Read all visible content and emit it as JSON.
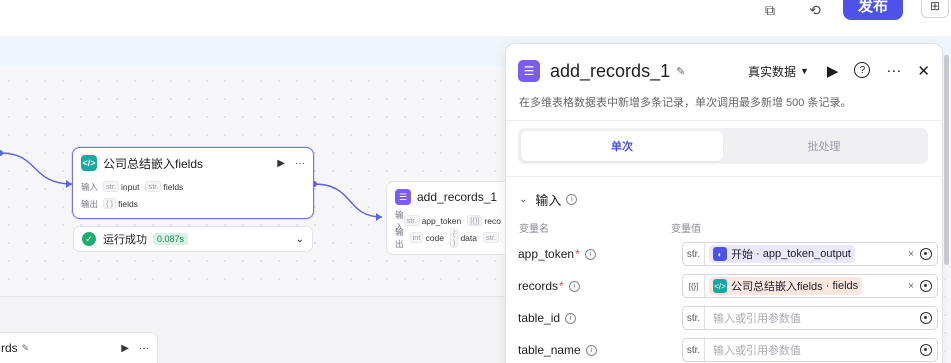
{
  "toolbar": {
    "publish_label": "发布"
  },
  "canvas": {
    "node_embed": {
      "title": "公司总结嵌入fields",
      "run_icon": "▶",
      "more_icon": "···",
      "input_label": "输入",
      "output_label": "输出",
      "inputs": [
        {
          "type": "str.",
          "name": "input"
        },
        {
          "type": "str.",
          "name": "fields"
        }
      ],
      "outputs": [
        {
          "type": "{ }",
          "name": "fields"
        }
      ]
    },
    "status": {
      "text": "运行成功",
      "time": "0.087s"
    },
    "node_add": {
      "title": "add_records_1",
      "input_label": "输入",
      "output_label": "输出",
      "inputs": [
        {
          "type": "str.",
          "name": "app_token"
        },
        {
          "type": "[{}]",
          "name": "reco"
        }
      ],
      "outputs": [
        {
          "type": "int",
          "name": "code"
        },
        {
          "type": "{ }",
          "name": "data"
        },
        {
          "type": "str.",
          "name": ""
        }
      ]
    },
    "node_partial": {
      "title": "rds",
      "run_icon": "▶",
      "more_icon": "···"
    }
  },
  "panel": {
    "title": "add_records_1",
    "data_source": "真实数据",
    "description": "在多维表格数据表中新增多条记录，单次调用最多新增 500 条记录。",
    "tabs": [
      {
        "label": "单次",
        "active": true
      },
      {
        "label": "批处理",
        "active": false
      }
    ],
    "section_title": "输入",
    "col_name": "变量名",
    "col_value": "变量值",
    "rows": [
      {
        "name": "app_token",
        "required": true,
        "type": "str.",
        "ref_node": "开始",
        "ref_var": "app_token_output",
        "placeholder": ""
      },
      {
        "name": "records",
        "required": true,
        "type": "[{}]",
        "ref_node": "公司总结嵌入fields",
        "ref_var": "fields",
        "placeholder": ""
      },
      {
        "name": "table_id",
        "required": false,
        "type": "str.",
        "ref_node": "",
        "ref_var": "",
        "placeholder": "输入或引用参数值"
      },
      {
        "name": "table_name",
        "required": false,
        "type": "str.",
        "ref_node": "",
        "ref_var": "",
        "placeholder": "输入或引用参数值"
      }
    ],
    "colors": {
      "accent": "#4d53e8",
      "start_chip": "#e9e8fd",
      "embed_chip": "#fde7e1",
      "success": "#1ead6f"
    }
  }
}
